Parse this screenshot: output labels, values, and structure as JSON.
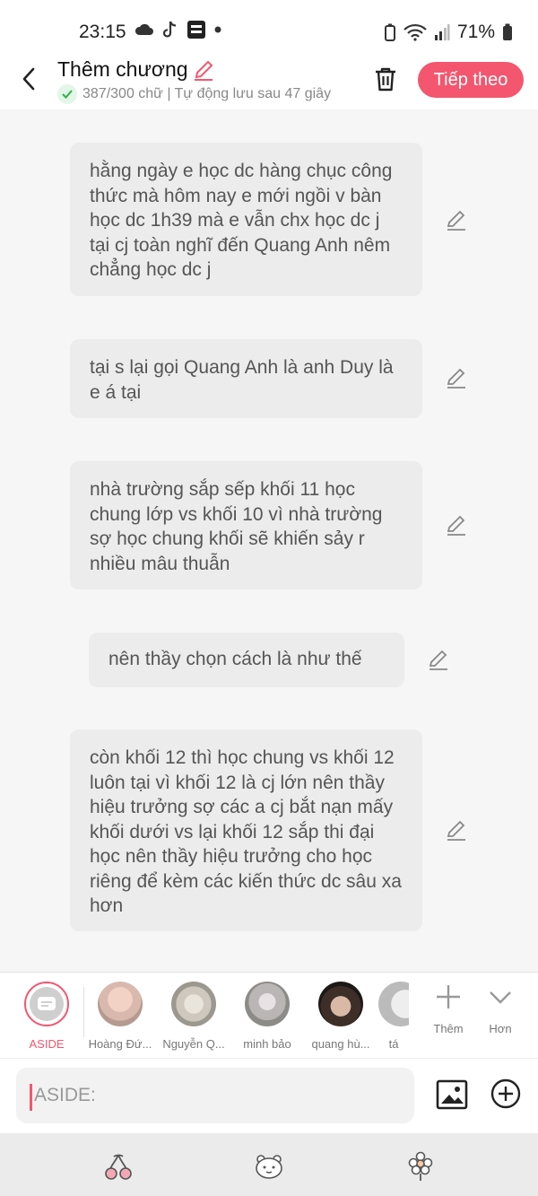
{
  "status": {
    "time": "23:15",
    "battery": "71%"
  },
  "header": {
    "title": "Thêm chương",
    "subtitle": "387/300 chữ | Tự động lưu sau 47 giây",
    "next_label": "Tiếp theo"
  },
  "messages": [
    "hằng ngày e học dc hàng chục công thức mà hôm nay e mới ngồi v bàn học dc 1h39 mà e vẫn chx học dc j tại cj toàn nghĩ đến Quang Anh nêm chẳng học dc j",
    "tại s lại gọi Quang Anh là anh Duy là e á tại",
    "nhà trường sắp sếp khối 11 học chung lớp vs khối 10 vì nhà trường sợ học chung khối sẽ khiến sảy r nhiều mâu thuẫn",
    "nên thầy chọn cách là như thế",
    "còn khối 12 thì học chung vs khối 12 luôn tại vì khối 12 là cj lớn nên thầy hiệu trưởng sợ các a cj bắt nạn mấy khối dưới vs lại khối 12 sắp thi đại học nên thầy hiệu trưởng cho học riêng để kèm các kiến thức dc sâu xa hơn"
  ],
  "characters": [
    {
      "name": "ASIDE"
    },
    {
      "name": "Hoàng Đứ..."
    },
    {
      "name": "Nguyễn Q..."
    },
    {
      "name": "minh bảo"
    },
    {
      "name": "quang hù..."
    },
    {
      "name": "tá"
    }
  ],
  "tools": {
    "add_label": "Thêm",
    "more_label": "Hơn"
  },
  "input": {
    "placeholder": "ASIDE:"
  },
  "colors": {
    "accent": "#f3566e",
    "bubble": "#ececec"
  }
}
